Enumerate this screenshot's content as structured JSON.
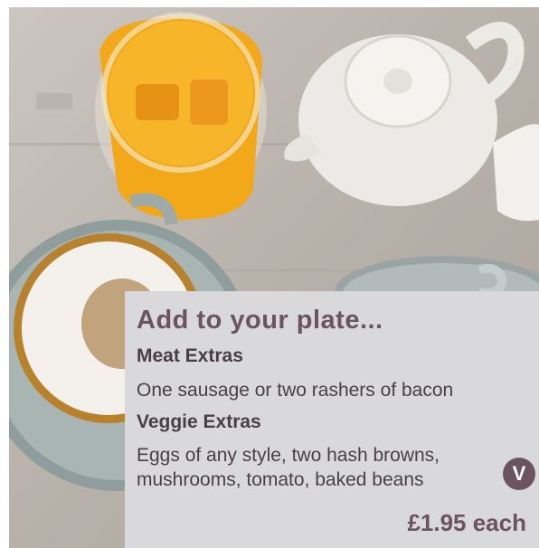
{
  "extras": {
    "title": "Add to your plate...",
    "meat": {
      "heading": "Meat Extras",
      "description": "One sausage or two rashers of bacon"
    },
    "veggie": {
      "heading": "Veggie Extras",
      "description_line1": "Eggs of any style, two hash browns,",
      "description_line2": "mushrooms, tomato, baked beans",
      "badge": "V"
    },
    "price": "£1.95 each"
  },
  "colors": {
    "accent": "#6b5360",
    "panel_background": "#d9d9db",
    "body_text": "#4a4043"
  }
}
